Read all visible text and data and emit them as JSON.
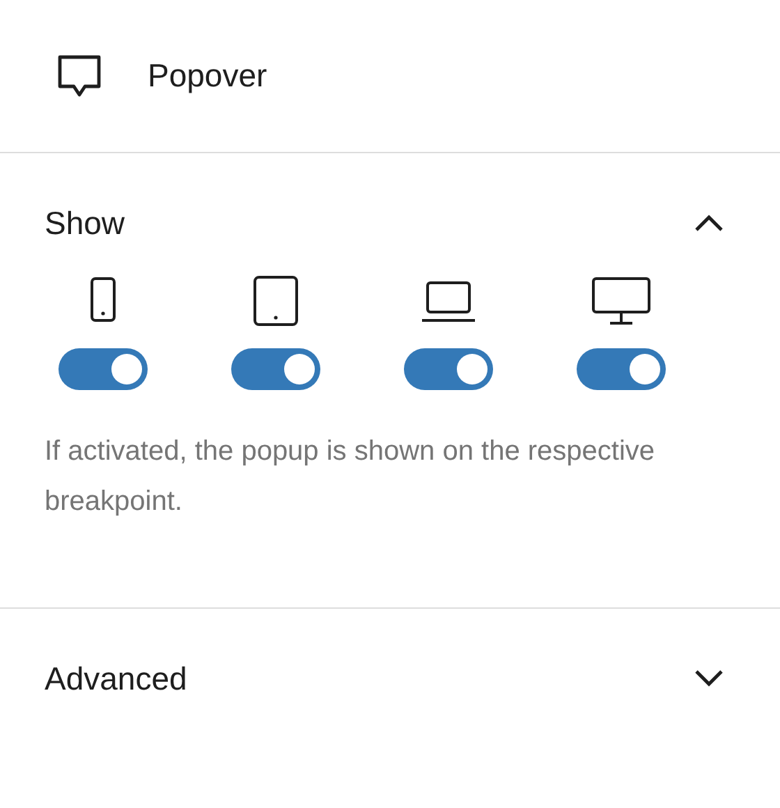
{
  "header": {
    "title": "Popover"
  },
  "panels": [
    {
      "title": "Show",
      "expanded": true,
      "breakpoints": [
        {
          "kind": "phone",
          "on": true
        },
        {
          "kind": "tablet",
          "on": true
        },
        {
          "kind": "laptop",
          "on": true
        },
        {
          "kind": "desktop",
          "on": true
        }
      ],
      "help": "If activated, the popup is shown on the respective breakpoint."
    },
    {
      "title": "Advanced",
      "expanded": false
    }
  ]
}
